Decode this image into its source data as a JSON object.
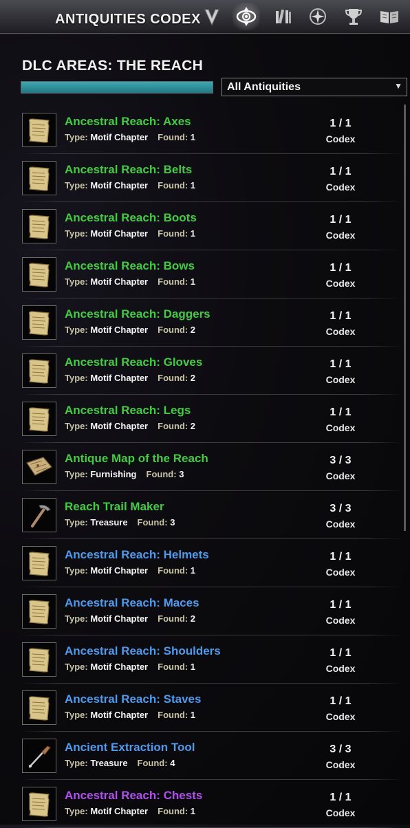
{
  "header": {
    "title": "ANTIQUITIES CODEX",
    "tabs": [
      {
        "icon": "scrying-icon"
      },
      {
        "icon": "codex-eye-icon",
        "active": true
      },
      {
        "icon": "bookshelf-icon"
      },
      {
        "icon": "compass-star-icon"
      },
      {
        "icon": "trophy-icon"
      },
      {
        "icon": "open-book-icon"
      }
    ]
  },
  "section": {
    "title": "DLC AREAS: THE REACH",
    "progress_fraction": 1.0
  },
  "filter": {
    "selected": "All Antiquities",
    "arrow": "▼"
  },
  "labels": {
    "type": "Type:",
    "found": "Found:"
  },
  "colors": {
    "green": "#3ecf3e",
    "blue": "#4a9cf0",
    "purple": "#b050f0"
  },
  "items": [
    {
      "name": "Ancestral Reach: Axes",
      "quality": "green",
      "type": "Motif Chapter",
      "found": "1",
      "count": "1 / 1",
      "kind": "Codex",
      "icon": "scroll-icon"
    },
    {
      "name": "Ancestral Reach: Belts",
      "quality": "green",
      "type": "Motif Chapter",
      "found": "1",
      "count": "1 / 1",
      "kind": "Codex",
      "icon": "scroll-icon"
    },
    {
      "name": "Ancestral Reach: Boots",
      "quality": "green",
      "type": "Motif Chapter",
      "found": "1",
      "count": "1 / 1",
      "kind": "Codex",
      "icon": "scroll-icon"
    },
    {
      "name": "Ancestral Reach: Bows",
      "quality": "green",
      "type": "Motif Chapter",
      "found": "1",
      "count": "1 / 1",
      "kind": "Codex",
      "icon": "scroll-icon"
    },
    {
      "name": "Ancestral Reach: Daggers",
      "quality": "green",
      "type": "Motif Chapter",
      "found": "2",
      "count": "1 / 1",
      "kind": "Codex",
      "icon": "scroll-icon"
    },
    {
      "name": "Ancestral Reach: Gloves",
      "quality": "green",
      "type": "Motif Chapter",
      "found": "2",
      "count": "1 / 1",
      "kind": "Codex",
      "icon": "scroll-icon"
    },
    {
      "name": "Ancestral Reach: Legs",
      "quality": "green",
      "type": "Motif Chapter",
      "found": "2",
      "count": "1 / 1",
      "kind": "Codex",
      "icon": "scroll-icon"
    },
    {
      "name": "Antique Map of the Reach",
      "quality": "green",
      "type": "Furnishing",
      "found": "3",
      "count": "3 / 3",
      "kind": "Codex",
      "icon": "map-icon"
    },
    {
      "name": "Reach Trail Maker",
      "quality": "green",
      "type": "Treasure",
      "found": "3",
      "count": "3 / 3",
      "kind": "Codex",
      "icon": "pick-hammer-icon"
    },
    {
      "name": "Ancestral Reach: Helmets",
      "quality": "blue",
      "type": "Motif Chapter",
      "found": "1",
      "count": "1 / 1",
      "kind": "Codex",
      "icon": "scroll-icon"
    },
    {
      "name": "Ancestral Reach: Maces",
      "quality": "blue",
      "type": "Motif Chapter",
      "found": "2",
      "count": "1 / 1",
      "kind": "Codex",
      "icon": "scroll-icon"
    },
    {
      "name": "Ancestral Reach: Shoulders",
      "quality": "blue",
      "type": "Motif Chapter",
      "found": "1",
      "count": "1 / 1",
      "kind": "Codex",
      "icon": "scroll-icon"
    },
    {
      "name": "Ancestral Reach: Staves",
      "quality": "blue",
      "type": "Motif Chapter",
      "found": "1",
      "count": "1 / 1",
      "kind": "Codex",
      "icon": "scroll-icon"
    },
    {
      "name": "Ancient Extraction Tool",
      "quality": "blue",
      "type": "Treasure",
      "found": "4",
      "count": "3 / 3",
      "kind": "Codex",
      "icon": "extraction-tool-icon"
    },
    {
      "name": "Ancestral Reach: Chests",
      "quality": "purple",
      "type": "Motif Chapter",
      "found": "1",
      "count": "1 / 1",
      "kind": "Codex",
      "icon": "scroll-icon"
    }
  ]
}
